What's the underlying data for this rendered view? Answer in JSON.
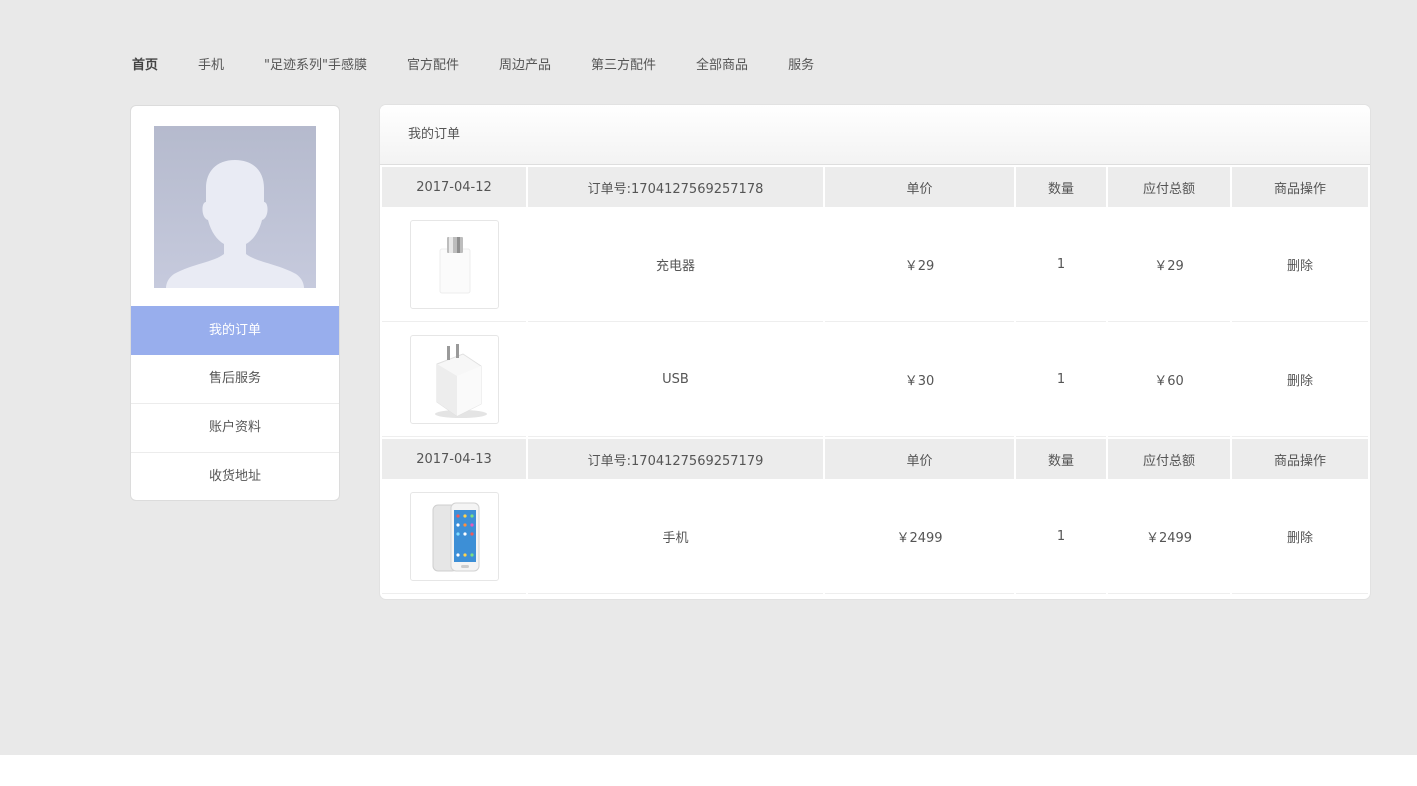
{
  "nav": {
    "items": [
      "首页",
      "手机",
      "\"足迹系列\"手感膜",
      "官方配件",
      "周边产品",
      "第三方配件",
      "全部商品",
      "服务"
    ]
  },
  "sidebar": {
    "items": [
      "我的订单",
      "售后服务",
      "账户资料",
      "收货地址"
    ],
    "active": "我的订单"
  },
  "main": {
    "title": "我的订单",
    "columns": {
      "price": "单价",
      "qty": "数量",
      "total": "应付总额",
      "ops": "商品操作"
    },
    "orders": [
      {
        "date": "2017-04-12",
        "order_no": "订单号:1704127569257178",
        "items": [
          {
            "image": "charger-adapter",
            "name": "充电器",
            "price": "￥29",
            "qty": "1",
            "total": "￥29",
            "action": "删除"
          },
          {
            "image": "wall-charger",
            "name": "USB",
            "price": "￥30",
            "qty": "1",
            "total": "￥60",
            "action": "删除"
          }
        ]
      },
      {
        "date": "2017-04-13",
        "order_no": "订单号:1704127569257179",
        "items": [
          {
            "image": "smartphone",
            "name": "手机",
            "price": "￥2499",
            "qty": "1",
            "total": "￥2499",
            "action": "删除"
          }
        ]
      }
    ]
  },
  "colors": {
    "page_bg": "#e9e9e9",
    "accent": "#98aeed",
    "header_cell": "#ececec"
  }
}
